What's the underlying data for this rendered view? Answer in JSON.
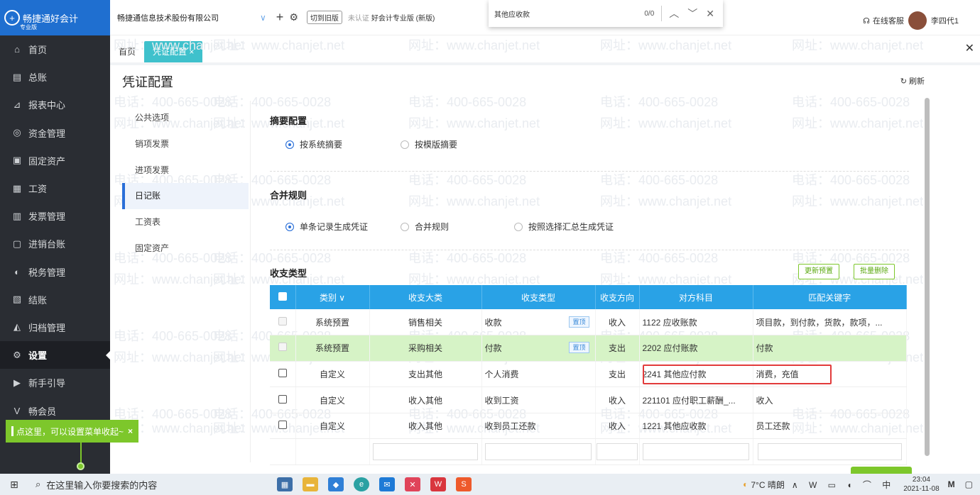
{
  "app": {
    "brand": "畅捷通好会计",
    "edition_tag": "专业版"
  },
  "sidebar": {
    "items": [
      {
        "icon": "home-icon",
        "glyph": "⌂",
        "label": "首页"
      },
      {
        "icon": "ledger-icon",
        "glyph": "▤",
        "label": "总账"
      },
      {
        "icon": "report-icon",
        "glyph": "⊿",
        "label": "报表中心"
      },
      {
        "icon": "money-icon",
        "glyph": "◎",
        "label": "资金管理"
      },
      {
        "icon": "asset-icon",
        "glyph": "▣",
        "label": "固定资产"
      },
      {
        "icon": "salary-icon",
        "glyph": "▦",
        "label": "工资"
      },
      {
        "icon": "invoice-icon",
        "glyph": "▥",
        "label": "发票管理"
      },
      {
        "icon": "inventory-icon",
        "glyph": "▢",
        "label": "进销台账"
      },
      {
        "icon": "tax-icon",
        "glyph": "◐",
        "label": "税务管理"
      },
      {
        "icon": "close-period-icon",
        "glyph": "▧",
        "label": "结账"
      },
      {
        "icon": "archive-icon",
        "glyph": "◭",
        "label": "归档管理"
      },
      {
        "icon": "gear-icon",
        "glyph": "⚙",
        "label": "设置"
      },
      {
        "icon": "guide-icon",
        "glyph": "▶",
        "label": "新手引导"
      },
      {
        "icon": "member-icon",
        "glyph": "V",
        "label": "畅会员"
      }
    ],
    "tip": "点这里，可以设置菜单收起~",
    "tip_close": "×"
  },
  "topbar": {
    "company": "畅捷通信息技术股份有限公司",
    "switch_old": "切到旧版",
    "verify": "未认证",
    "edition": "好会计专业版 (新版)",
    "support": "在线客服",
    "user": "李四代1"
  },
  "findbar": {
    "query": "其他应收款",
    "count": "0/0"
  },
  "tabs": [
    {
      "label": "首页"
    },
    {
      "label": "凭证配置 ×"
    }
  ],
  "page": {
    "title": "凭证配置",
    "refresh": "刷新"
  },
  "submenu": [
    "公共选项",
    "销项发票",
    "进项发票",
    "日记账",
    "工资表",
    "固定资产"
  ],
  "summary": {
    "title": "摘要配置",
    "options": [
      "按系统摘要",
      "按模版摘要"
    ]
  },
  "merge": {
    "title": "合并规则",
    "options": [
      "单条记录生成凭证",
      "合并规则",
      "按照选择汇总生成凭证"
    ]
  },
  "types": {
    "title": "收支类型",
    "btn_update": "更新预置",
    "btn_delete": "批量删除",
    "columns": [
      "类别 ∨",
      "收支大类",
      "收支类型",
      "收支方向",
      "对方科目",
      "匹配关键字"
    ],
    "rows": [
      {
        "category": "系统预置",
        "major": "销售相关",
        "type": "收款",
        "tag": "置顶",
        "dir": "收入",
        "account": "1122 应收账款",
        "keywords": "项目款，到付款，货款，款项，..."
      },
      {
        "category": "系统预置",
        "major": "采购相关",
        "type": "付款",
        "tag": "置顶",
        "dir": "支出",
        "account": "2202 应付账款",
        "keywords": "付款"
      },
      {
        "category": "自定义",
        "major": "支出其他",
        "type": "个人消费",
        "tag": "",
        "dir": "支出",
        "account": "2241 其他应付款",
        "keywords": "消费，充值"
      },
      {
        "category": "自定义",
        "major": "收入其他",
        "type": "收到工资",
        "tag": "",
        "dir": "收入",
        "account": "221101 应付职工薪酬_...",
        "keywords": "收入"
      },
      {
        "category": "自定义",
        "major": "收入其他",
        "type": "收到员工还款",
        "tag": "",
        "dir": "收入",
        "account": "1221 其他应收款",
        "keywords": "员工还款"
      }
    ]
  },
  "watermark": {
    "phone": "电话：400-665-0028",
    "site": "网址：www.chanjet.net"
  },
  "taskbar": {
    "search": "在这里输入你要搜索的内容",
    "weather": "7°C 晴朗",
    "time": "23:04",
    "date": "2021-11-08"
  }
}
